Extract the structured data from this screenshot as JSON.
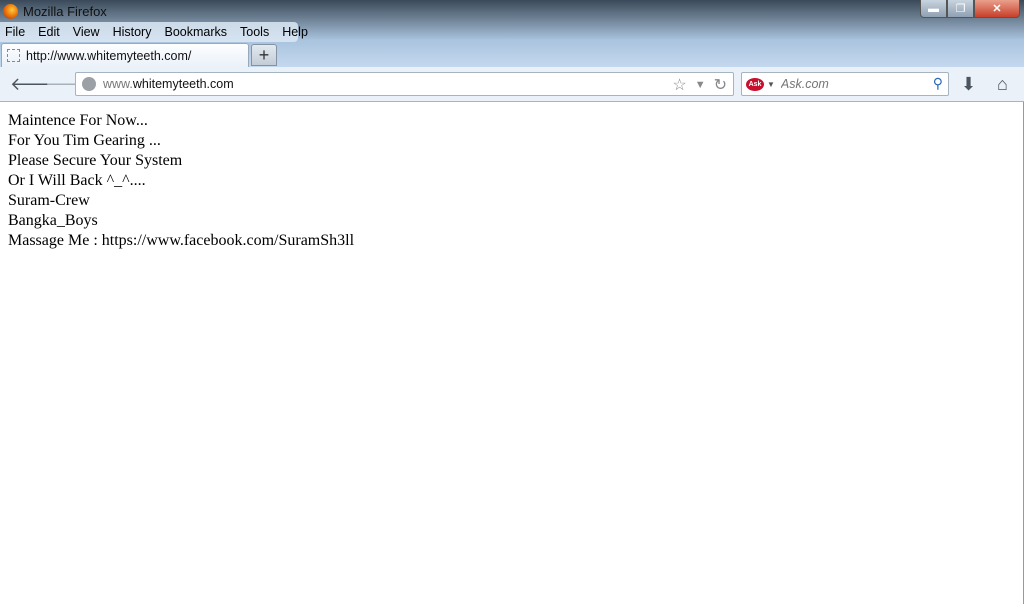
{
  "window": {
    "title": "Mozilla Firefox",
    "controls": [
      "minimize",
      "restore",
      "close"
    ]
  },
  "menu": [
    "File",
    "Edit",
    "View",
    "History",
    "Bookmarks",
    "Tools",
    "Help"
  ],
  "tab": {
    "label": "http://www.whitemyteeth.com/",
    "new_tab": "+"
  },
  "nav": {
    "url_prefix": "www.",
    "url_domain": "whitemyteeth.com",
    "search_placeholder": "Ask.com",
    "search_engine": "Ask"
  },
  "content": {
    "lines": [
      "Maintence For Now...",
      "For You Tim Gearing ...",
      "Please Secure Your System",
      "Or I Will Back ^_^....",
      "Suram-Crew",
      "Bangka_Boys",
      "Massage Me : https://www.facebook.com/SuramSh3ll"
    ]
  }
}
